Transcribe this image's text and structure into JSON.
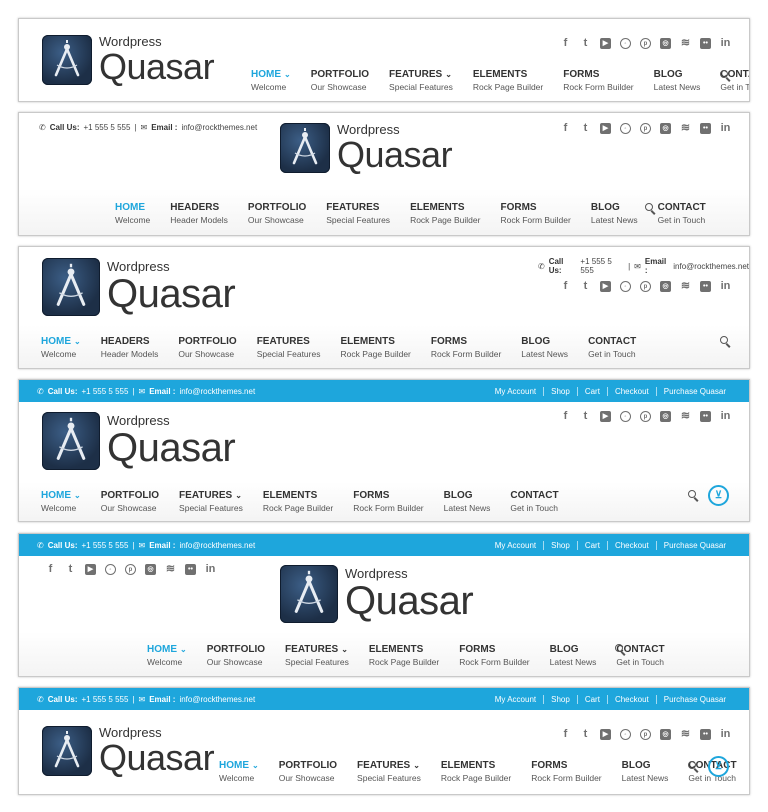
{
  "logo": {
    "small": "Wordpress",
    "big": "Quasar"
  },
  "contact": {
    "call_label": "Call Us:",
    "phone": "+1 555 5 555",
    "sep": "|",
    "email_label": "Email :",
    "email": "info@rockthemes.net"
  },
  "topbar_links": [
    "My Account",
    "Shop",
    "Cart",
    "Checkout",
    "Purchase Quasar"
  ],
  "social_icons": [
    "facebook-icon",
    "twitter-icon",
    "youtube-icon",
    "dribbble-icon",
    "pinterest-icon",
    "instagram-icon",
    "stumbleupon-icon",
    "flickr-icon",
    "linkedin-icon"
  ],
  "nav": {
    "home": {
      "title": "HOME",
      "sub": "Welcome"
    },
    "headers": {
      "title": "HEADERS",
      "sub": "Header Models"
    },
    "portfolio": {
      "title": "PORTFOLIO",
      "sub": "Our Showcase"
    },
    "features": {
      "title": "FEATURES",
      "sub": "Special Features"
    },
    "elements": {
      "title": "ELEMENTS",
      "sub": "Rock Page Builder"
    },
    "forms": {
      "title": "FORMS",
      "sub": "Rock Form Builder"
    },
    "blog": {
      "title": "BLOG",
      "sub": "Latest News"
    },
    "contact": {
      "title": "CONTACT",
      "sub": "Get in Touch"
    }
  },
  "colors": {
    "accent": "#1ea6dc",
    "text": "#333333",
    "icon": "#707070"
  }
}
